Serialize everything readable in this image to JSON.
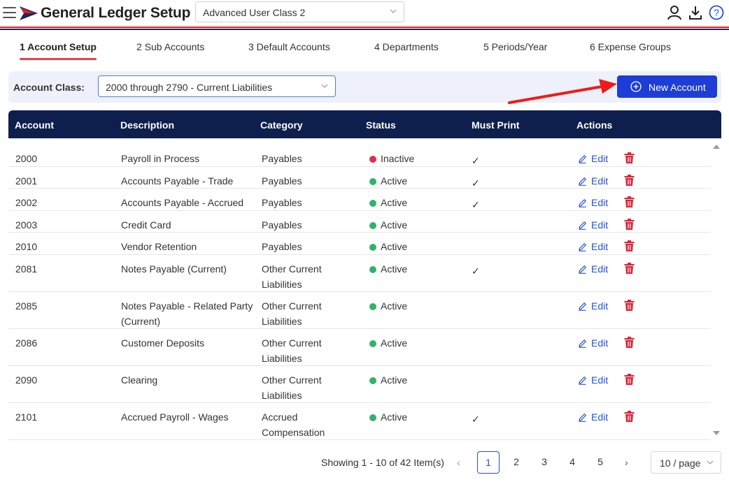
{
  "header": {
    "title": "General Ledger Setup",
    "user_class": "Advanced User Class 2",
    "icons": [
      "menu-icon",
      "logo-icon",
      "user-icon",
      "download-icon",
      "help-icon"
    ]
  },
  "tabs": [
    {
      "label": "1 Account Setup",
      "active": true
    },
    {
      "label": "2 Sub Accounts",
      "active": false
    },
    {
      "label": "3 Default Accounts",
      "active": false
    },
    {
      "label": "4 Departments",
      "active": false
    },
    {
      "label": "5 Periods/Year",
      "active": false
    },
    {
      "label": "6 Expense Groups",
      "active": false
    }
  ],
  "filter": {
    "label": "Account Class:",
    "selected": "2000 through 2790 - Current Liabilities",
    "new_button": "New Account"
  },
  "table": {
    "columns": [
      "Account",
      "Description",
      "Category",
      "Status",
      "Must Print",
      "Actions"
    ],
    "edit_label": "Edit",
    "rows": [
      {
        "account": "2000",
        "description": "Payroll in Process",
        "category": "Payables",
        "status": "Inactive",
        "must_print": "✓"
      },
      {
        "account": "2001",
        "description": "Accounts Payable - Trade",
        "category": "Payables",
        "status": "Active",
        "must_print": "✓"
      },
      {
        "account": "2002",
        "description": "Accounts Payable - Accrued",
        "category": "Payables",
        "status": "Active",
        "must_print": "✓"
      },
      {
        "account": "2003",
        "description": "Credit Card",
        "category": "Payables",
        "status": "Active",
        "must_print": ""
      },
      {
        "account": "2010",
        "description": "Vendor Retention",
        "category": "Payables",
        "status": "Active",
        "must_print": ""
      },
      {
        "account": "2081",
        "description": "Notes Payable (Current)",
        "category": "Other Current Liabilities",
        "status": "Active",
        "must_print": "✓"
      },
      {
        "account": "2085",
        "description": "Notes Payable - Related Party (Current)",
        "category": "Other Current Liabilities",
        "status": "Active",
        "must_print": ""
      },
      {
        "account": "2086",
        "description": "Customer Deposits",
        "category": "Other Current Liabilities",
        "status": "Active",
        "must_print": ""
      },
      {
        "account": "2090",
        "description": "Clearing",
        "category": "Other Current Liabilities",
        "status": "Active",
        "must_print": ""
      },
      {
        "account": "2101",
        "description": "Accrued Payroll - Wages",
        "category": "Accrued Compensation",
        "status": "Active",
        "must_print": "✓"
      }
    ]
  },
  "pagination": {
    "summary": "Showing 1 - 10 of 42 Item(s)",
    "prev": "‹",
    "next": "›",
    "pages": [
      "1",
      "2",
      "3",
      "4",
      "5"
    ],
    "current": "1",
    "page_size": "10 / page"
  },
  "colors": {
    "navy": "#0e1f4d",
    "accent_red": "#e8414b",
    "primary_blue": "#1d3dd6",
    "active_green": "#2fb36a",
    "inactive_red": "#e02f49",
    "delete_red": "#d9263a"
  }
}
